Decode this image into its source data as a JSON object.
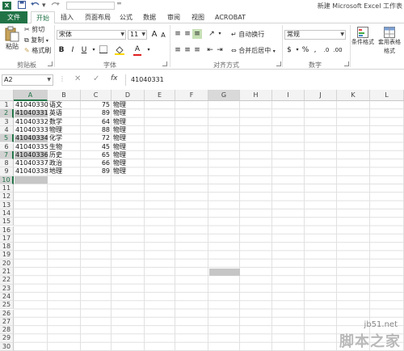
{
  "window": {
    "title": "新建 Microsoft Excel 工作表",
    "app_icon": "X",
    "qat": {
      "save_icon": "save-icon",
      "undo_icon": "undo-icon",
      "redo_icon": "redo-icon"
    }
  },
  "ribbon_tabs": [
    "文件",
    "开始",
    "插入",
    "页面布局",
    "公式",
    "数据",
    "审阅",
    "视图",
    "ACROBAT"
  ],
  "ribbon": {
    "clipboard": {
      "label": "剪贴板",
      "paste": "粘贴",
      "cut": "剪切",
      "copy": "复制",
      "format_painter": "格式刷"
    },
    "font": {
      "label": "字体",
      "font_name": "宋体",
      "font_size": "11",
      "bold": "B",
      "italic": "I",
      "underline": "U",
      "font_color": "A",
      "grow": "A",
      "shrink": "A"
    },
    "alignment": {
      "label": "对齐方式",
      "wrap_text": "自动换行",
      "merge_center": "合并后居中"
    },
    "number": {
      "label": "数字",
      "format": "常规",
      "percent": "%",
      "comma": ","
    },
    "styles": {
      "conditional_format": "条件格式",
      "format_table": "套用表格格式"
    }
  },
  "formula_bar": {
    "name_box": "A2",
    "fx": "fx",
    "value": "41040331",
    "cancel": "✕",
    "enter": "✓"
  },
  "columns": [
    "A",
    "B",
    "C",
    "D",
    "E",
    "F",
    "G",
    "H",
    "I",
    "J",
    "K",
    "L"
  ],
  "rows": [
    "1",
    "2",
    "3",
    "4",
    "5",
    "6",
    "7",
    "8",
    "9",
    "10",
    "11",
    "12",
    "13",
    "14",
    "15",
    "16",
    "17",
    "18",
    "19",
    "20",
    "21",
    "22",
    "23",
    "24",
    "25",
    "26",
    "27",
    "28",
    "29",
    "30"
  ],
  "data": [
    {
      "id": "41040330",
      "subject": "语文",
      "score": "75",
      "note": "物理"
    },
    {
      "id": "41040331",
      "subject": "英语",
      "score": "89",
      "note": "物理"
    },
    {
      "id": "41040332",
      "subject": "数学",
      "score": "64",
      "note": "物理"
    },
    {
      "id": "41040333",
      "subject": "物理",
      "score": "88",
      "note": "物理"
    },
    {
      "id": "41040334",
      "subject": "化学",
      "score": "72",
      "note": "物理"
    },
    {
      "id": "41040335",
      "subject": "生物",
      "score": "45",
      "note": "物理"
    },
    {
      "id": "41040336",
      "subject": "历史",
      "score": "65",
      "note": "物理"
    },
    {
      "id": "41040337",
      "subject": "政治",
      "score": "66",
      "note": "物理"
    },
    {
      "id": "41040338",
      "subject": "地理",
      "score": "89",
      "note": "物理"
    }
  ],
  "watermark": {
    "line1": "jb51.net",
    "line2": "脚本之家"
  },
  "colors": {
    "accent": "#217346",
    "selection": "#c6c6c6"
  }
}
